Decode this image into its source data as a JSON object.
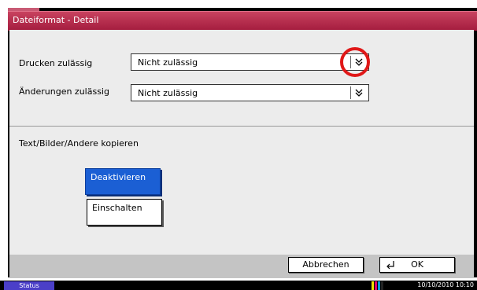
{
  "dialog": {
    "title": "Dateiformat - Detail"
  },
  "fields": [
    {
      "label": "Drucken zulässig",
      "value": "Nicht zulässig"
    },
    {
      "label": "Änderungen zulässig",
      "value": "Nicht zulässig"
    }
  ],
  "copy_section": {
    "label": "Text/Bilder/Andere kopieren",
    "options": [
      {
        "label": "Deaktivieren",
        "selected": true
      },
      {
        "label": "Einschalten",
        "selected": false
      }
    ]
  },
  "buttons": {
    "cancel": "Abbrechen",
    "ok": "OK"
  },
  "status": {
    "tab": "Status",
    "datetime": "10/10/2010   10:10"
  },
  "colors": {
    "title_bar": "#b0294a",
    "selected_option": "#1b5fd4",
    "highlight_circle": "#e01818"
  }
}
